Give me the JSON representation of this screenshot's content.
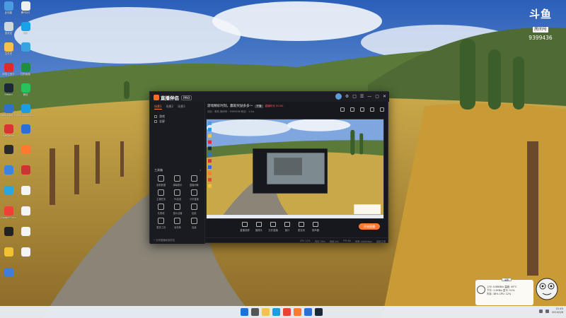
{
  "logo": {
    "brand": "斗鱼",
    "sub": "房间号",
    "room_id": "9399436"
  },
  "desktop_icons": [
    {
      "label": "此电脑",
      "color": "#4a9be0"
    },
    {
      "label": "腾讯QQ",
      "color": "#f0f0f0"
    },
    {
      "label": "回收站",
      "color": "#cfd8dc"
    },
    {
      "label": "QQ",
      "color": "#1aa1e6"
    },
    {
      "label": "文件夹",
      "color": "#f2c14e"
    },
    {
      "label": "",
      "color": "#38a3e0"
    },
    {
      "label": "网易云音乐",
      "color": "#e02b2b"
    },
    {
      "label": "控制面板",
      "color": "#1f8f3f"
    },
    {
      "label": "Steam",
      "color": "#1b2838"
    },
    {
      "label": "微信",
      "color": "#2bc15e"
    },
    {
      "label": "Wallpaper Engine",
      "color": "#2f72c9"
    },
    {
      "label": "Microsoft Edge",
      "color": "#1b9de2"
    },
    {
      "label": "WeGame",
      "color": "#d83434"
    },
    {
      "label": "",
      "color": "#2c6fd8"
    },
    {
      "label": "",
      "color": "#2a2a2a"
    },
    {
      "label": "",
      "color": "#ff7a2e"
    },
    {
      "label": "",
      "color": "#3a86d8"
    },
    {
      "label": "",
      "color": "#c33"
    },
    {
      "label": "",
      "color": "#2aa7df"
    },
    {
      "label": "",
      "color": "#f4f4f4"
    },
    {
      "label": "Google Chrome",
      "color": "#ea4335"
    },
    {
      "label": "",
      "color": "#f4f4f4"
    },
    {
      "label": "",
      "color": "#222"
    },
    {
      "label": "",
      "color": "#f4f4f4"
    },
    {
      "label": "",
      "color": "#f1c232"
    },
    {
      "label": "",
      "color": "#f4f4f4"
    },
    {
      "label": "",
      "color": "#3d7ed8"
    }
  ],
  "app": {
    "title": "直播伴侣",
    "version": "PRO",
    "window_controls": [
      "头像",
      "⚙",
      "□",
      "☰",
      "—",
      "▢",
      "✕"
    ],
    "scene_tabs": [
      {
        "label": "场景1",
        "active": true
      },
      {
        "label": "场景2",
        "active": false
      },
      {
        "label": "场景3",
        "active": false
      }
    ],
    "scene_items": [
      "游戏",
      "全屏"
    ],
    "tools_title": "工具箱",
    "tools_more": "›",
    "tools": [
      {
        "label": "观看数据"
      },
      {
        "label": "弹幕助手"
      },
      {
        "label": "直播间管"
      },
      {
        "label": "主播任务"
      },
      {
        "label": "PK连麦"
      },
      {
        "label": "分享直播"
      },
      {
        "label": "礼物墙"
      },
      {
        "label": "音乐点播"
      },
      {
        "label": "贴纸"
      },
      {
        "label": "更多工具"
      },
      {
        "label": "素材库"
      },
      {
        "label": "高级"
      }
    ],
    "left_footer": "• 分享直播间到好友",
    "stream_title": "游戏精彩时刻，赢取奖励多多～",
    "stream_tag": "开播",
    "stream_live": "直播时长 00:00",
    "stream_meta": "分区：单机  房间号：9399436  粉丝：1.2w",
    "bottom_tools": [
      {
        "label": "直播录屏"
      },
      {
        "label": "摄像头"
      },
      {
        "label": "文件直播"
      },
      {
        "label": "窗口"
      },
      {
        "label": "麦克风"
      },
      {
        "label": "扬声器"
      }
    ],
    "go_live_label": "开始直播",
    "status": [
      "CPU 12%",
      "内存 38%",
      "丢帧 0%",
      "FPS 60",
      "码率 4000kbps",
      "连接正常"
    ]
  },
  "widget": {
    "button": "设置",
    "rows": [
      "上行: 0.68KB/s  温度: 45°C",
      "下行: 1.2KB/s  显卡: 51%",
      "内存: 38%  CPU: 12%"
    ]
  },
  "taskbar": {
    "icons": [
      {
        "name": "windows-start",
        "color": "#1a73d9"
      },
      {
        "name": "search",
        "color": "#555"
      },
      {
        "name": "file-explorer",
        "color": "#f2c14e"
      },
      {
        "name": "edge",
        "color": "#1b9de2"
      },
      {
        "name": "chrome",
        "color": "#ea4335"
      },
      {
        "name": "app-orange",
        "color": "#ff7a2e"
      },
      {
        "name": "app-blue",
        "color": "#2c6fd8"
      },
      {
        "name": "steam",
        "color": "#1b2838"
      }
    ],
    "time": "21:45",
    "date": "2024/3/8"
  }
}
